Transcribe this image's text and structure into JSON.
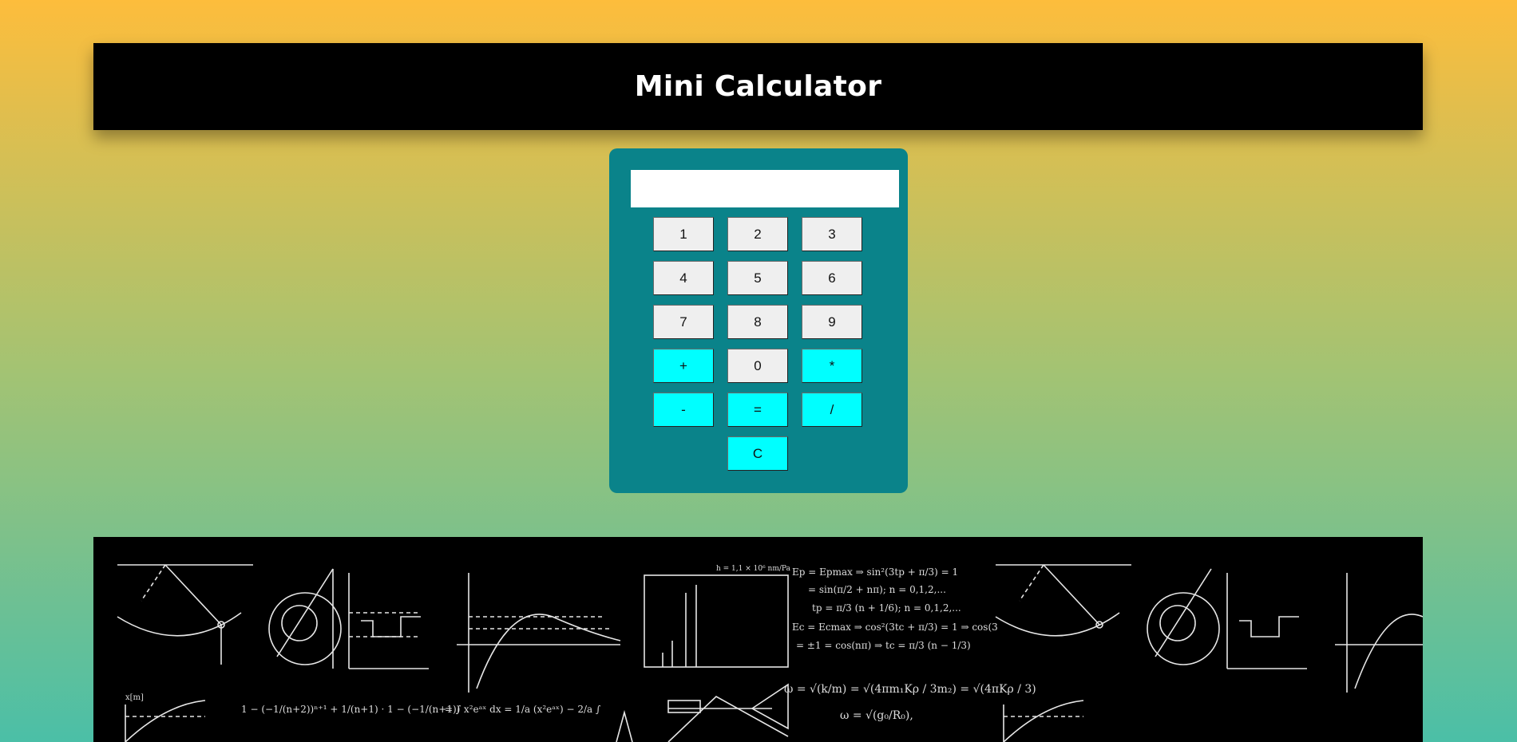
{
  "header": {
    "title": "Mini Calculator"
  },
  "calculator": {
    "display_value": "",
    "keys": [
      {
        "label": "1",
        "kind": "digit"
      },
      {
        "label": "2",
        "kind": "digit"
      },
      {
        "label": "3",
        "kind": "digit"
      },
      {
        "label": "4",
        "kind": "digit"
      },
      {
        "label": "5",
        "kind": "digit"
      },
      {
        "label": "6",
        "kind": "digit"
      },
      {
        "label": "7",
        "kind": "digit"
      },
      {
        "label": "8",
        "kind": "digit"
      },
      {
        "label": "9",
        "kind": "digit"
      },
      {
        "label": "+",
        "kind": "operator"
      },
      {
        "label": "0",
        "kind": "digit"
      },
      {
        "label": "*",
        "kind": "operator"
      },
      {
        "label": "-",
        "kind": "operator"
      },
      {
        "label": "=",
        "kind": "operator"
      },
      {
        "label": "/",
        "kind": "operator"
      },
      {
        "label": "C",
        "kind": "clear"
      }
    ]
  },
  "colors": {
    "header_bg": "#000000",
    "calculator_bg": "#0a838a",
    "digit_key_bg": "#efefef",
    "operator_key_bg": "#00ffff",
    "banner_bg": "#000000"
  },
  "banner": {
    "image": "math-formulas-chalkboard-image",
    "labels": {
      "ep": "Ep = Epmax ⇒ sin²(3tp + π/3) = 1",
      "sin": "= sin(π/2 + nπ); n = 0,1,2,...",
      "tp": "tp = π/3 (n + 1/6); n = 0,1,2,...",
      "ec": "Ec = Ecmax ⇒ cos²(3tc + π/3) = 1 ⇒ cos(3",
      "pm": "= ±1 = cos(nπ) ⇒ tc = π/3 (n − 1/3)",
      "omega1": "ω = √(k/m) = √(4πm₁Kρ / 3m₂) = √(4πKρ / 3)",
      "omega2": "ω = √(g₀/R₀),",
      "sum": "1 − (−1/(n+2))ⁿ⁺¹ + 1/(n+1) · 1 − (−1/(n+1))",
      "integral": "= ∫ x²eᵃˣ dx = 1/a (x²eᵃˣ) − 2/a ∫",
      "spec": "h = 1,1 × 10⁶ nm/Pa",
      "xm": "x[m]"
    }
  }
}
